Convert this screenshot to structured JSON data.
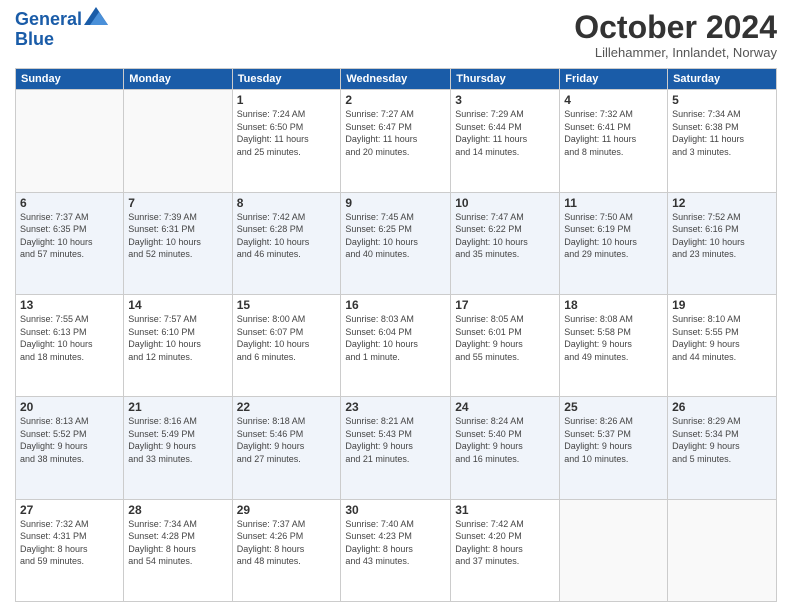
{
  "header": {
    "logo_line1": "General",
    "logo_line2": "Blue",
    "month": "October 2024",
    "location": "Lillehammer, Innlandet, Norway"
  },
  "weekdays": [
    "Sunday",
    "Monday",
    "Tuesday",
    "Wednesday",
    "Thursday",
    "Friday",
    "Saturday"
  ],
  "weeks": [
    [
      {
        "day": "",
        "info": ""
      },
      {
        "day": "",
        "info": ""
      },
      {
        "day": "1",
        "info": "Sunrise: 7:24 AM\nSunset: 6:50 PM\nDaylight: 11 hours\nand 25 minutes."
      },
      {
        "day": "2",
        "info": "Sunrise: 7:27 AM\nSunset: 6:47 PM\nDaylight: 11 hours\nand 20 minutes."
      },
      {
        "day": "3",
        "info": "Sunrise: 7:29 AM\nSunset: 6:44 PM\nDaylight: 11 hours\nand 14 minutes."
      },
      {
        "day": "4",
        "info": "Sunrise: 7:32 AM\nSunset: 6:41 PM\nDaylight: 11 hours\nand 8 minutes."
      },
      {
        "day": "5",
        "info": "Sunrise: 7:34 AM\nSunset: 6:38 PM\nDaylight: 11 hours\nand 3 minutes."
      }
    ],
    [
      {
        "day": "6",
        "info": "Sunrise: 7:37 AM\nSunset: 6:35 PM\nDaylight: 10 hours\nand 57 minutes."
      },
      {
        "day": "7",
        "info": "Sunrise: 7:39 AM\nSunset: 6:31 PM\nDaylight: 10 hours\nand 52 minutes."
      },
      {
        "day": "8",
        "info": "Sunrise: 7:42 AM\nSunset: 6:28 PM\nDaylight: 10 hours\nand 46 minutes."
      },
      {
        "day": "9",
        "info": "Sunrise: 7:45 AM\nSunset: 6:25 PM\nDaylight: 10 hours\nand 40 minutes."
      },
      {
        "day": "10",
        "info": "Sunrise: 7:47 AM\nSunset: 6:22 PM\nDaylight: 10 hours\nand 35 minutes."
      },
      {
        "day": "11",
        "info": "Sunrise: 7:50 AM\nSunset: 6:19 PM\nDaylight: 10 hours\nand 29 minutes."
      },
      {
        "day": "12",
        "info": "Sunrise: 7:52 AM\nSunset: 6:16 PM\nDaylight: 10 hours\nand 23 minutes."
      }
    ],
    [
      {
        "day": "13",
        "info": "Sunrise: 7:55 AM\nSunset: 6:13 PM\nDaylight: 10 hours\nand 18 minutes."
      },
      {
        "day": "14",
        "info": "Sunrise: 7:57 AM\nSunset: 6:10 PM\nDaylight: 10 hours\nand 12 minutes."
      },
      {
        "day": "15",
        "info": "Sunrise: 8:00 AM\nSunset: 6:07 PM\nDaylight: 10 hours\nand 6 minutes."
      },
      {
        "day": "16",
        "info": "Sunrise: 8:03 AM\nSunset: 6:04 PM\nDaylight: 10 hours\nand 1 minute."
      },
      {
        "day": "17",
        "info": "Sunrise: 8:05 AM\nSunset: 6:01 PM\nDaylight: 9 hours\nand 55 minutes."
      },
      {
        "day": "18",
        "info": "Sunrise: 8:08 AM\nSunset: 5:58 PM\nDaylight: 9 hours\nand 49 minutes."
      },
      {
        "day": "19",
        "info": "Sunrise: 8:10 AM\nSunset: 5:55 PM\nDaylight: 9 hours\nand 44 minutes."
      }
    ],
    [
      {
        "day": "20",
        "info": "Sunrise: 8:13 AM\nSunset: 5:52 PM\nDaylight: 9 hours\nand 38 minutes."
      },
      {
        "day": "21",
        "info": "Sunrise: 8:16 AM\nSunset: 5:49 PM\nDaylight: 9 hours\nand 33 minutes."
      },
      {
        "day": "22",
        "info": "Sunrise: 8:18 AM\nSunset: 5:46 PM\nDaylight: 9 hours\nand 27 minutes."
      },
      {
        "day": "23",
        "info": "Sunrise: 8:21 AM\nSunset: 5:43 PM\nDaylight: 9 hours\nand 21 minutes."
      },
      {
        "day": "24",
        "info": "Sunrise: 8:24 AM\nSunset: 5:40 PM\nDaylight: 9 hours\nand 16 minutes."
      },
      {
        "day": "25",
        "info": "Sunrise: 8:26 AM\nSunset: 5:37 PM\nDaylight: 9 hours\nand 10 minutes."
      },
      {
        "day": "26",
        "info": "Sunrise: 8:29 AM\nSunset: 5:34 PM\nDaylight: 9 hours\nand 5 minutes."
      }
    ],
    [
      {
        "day": "27",
        "info": "Sunrise: 7:32 AM\nSunset: 4:31 PM\nDaylight: 8 hours\nand 59 minutes."
      },
      {
        "day": "28",
        "info": "Sunrise: 7:34 AM\nSunset: 4:28 PM\nDaylight: 8 hours\nand 54 minutes."
      },
      {
        "day": "29",
        "info": "Sunrise: 7:37 AM\nSunset: 4:26 PM\nDaylight: 8 hours\nand 48 minutes."
      },
      {
        "day": "30",
        "info": "Sunrise: 7:40 AM\nSunset: 4:23 PM\nDaylight: 8 hours\nand 43 minutes."
      },
      {
        "day": "31",
        "info": "Sunrise: 7:42 AM\nSunset: 4:20 PM\nDaylight: 8 hours\nand 37 minutes."
      },
      {
        "day": "",
        "info": ""
      },
      {
        "day": "",
        "info": ""
      }
    ]
  ]
}
